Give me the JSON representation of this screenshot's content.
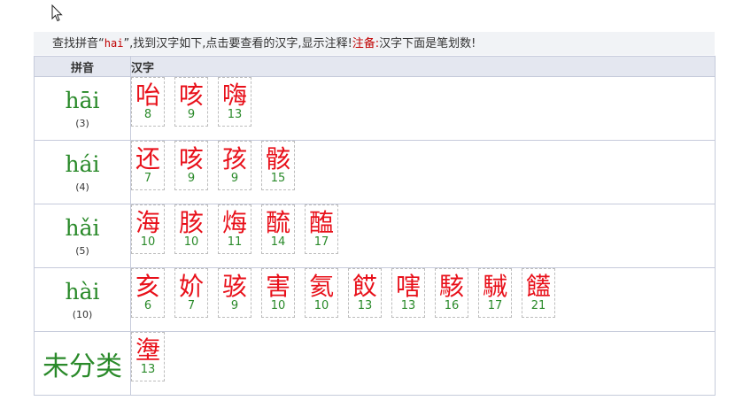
{
  "notice": {
    "prefix": "查找拼音“",
    "keyword": "hai",
    "middle": "”,找到汉字如下,点击要查看的汉字,显示注释!",
    "note_label": "注备:",
    "note_text": "汉字下面是笔划数!"
  },
  "table": {
    "headers": {
      "pinyin": "拼音",
      "hanzi": "汉字"
    },
    "rows": [
      {
        "pinyin": "hāi",
        "count": "(3)",
        "chars": [
          {
            "c": "咍",
            "s": "8"
          },
          {
            "c": "咳",
            "s": "9"
          },
          {
            "c": "嗨",
            "s": "13"
          }
        ]
      },
      {
        "pinyin": "hái",
        "count": "(4)",
        "chars": [
          {
            "c": "还",
            "s": "7"
          },
          {
            "c": "咳",
            "s": "9"
          },
          {
            "c": "孩",
            "s": "9"
          },
          {
            "c": "骸",
            "s": "15"
          }
        ]
      },
      {
        "pinyin": "hǎi",
        "count": "(5)",
        "chars": [
          {
            "c": "海",
            "s": "10"
          },
          {
            "c": "胲",
            "s": "10"
          },
          {
            "c": "烸",
            "s": "11"
          },
          {
            "c": "酼",
            "s": "14"
          },
          {
            "c": "醢",
            "s": "17"
          }
        ]
      },
      {
        "pinyin": "hài",
        "count": "(10)",
        "chars": [
          {
            "c": "亥",
            "s": "6"
          },
          {
            "c": "妎",
            "s": "7"
          },
          {
            "c": "骇",
            "s": "9"
          },
          {
            "c": "害",
            "s": "10"
          },
          {
            "c": "氦",
            "s": "10"
          },
          {
            "c": "餀",
            "s": "13"
          },
          {
            "c": "嗐",
            "s": "13"
          },
          {
            "c": "駭",
            "s": "16"
          },
          {
            "c": "駴",
            "s": "17"
          },
          {
            "c": "饚",
            "s": "21"
          }
        ]
      },
      {
        "pinyin": "未分类",
        "count": "",
        "uncategorized": true,
        "chars": [
          {
            "c": "塰",
            "s": "13"
          }
        ]
      }
    ]
  }
}
